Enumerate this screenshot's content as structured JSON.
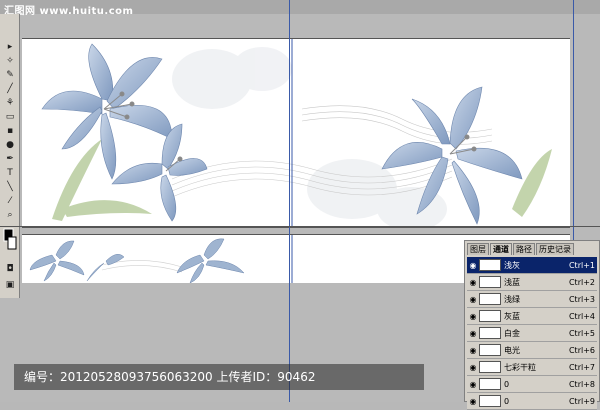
{
  "watermark": {
    "site": "汇图网 www.huitu.com"
  },
  "caption": {
    "text": "编号：20120528093756063200 上传者ID：90462"
  },
  "channels_panel": {
    "tabs": [
      {
        "label": "图层",
        "active": false
      },
      {
        "label": "通道",
        "active": true
      },
      {
        "label": "路径",
        "active": false
      },
      {
        "label": "历史记录",
        "active": false
      }
    ],
    "rows": [
      {
        "name": "浅灰",
        "shortcut": "Ctrl+1",
        "selected": true
      },
      {
        "name": "浅蓝",
        "shortcut": "Ctrl+2",
        "selected": false
      },
      {
        "name": "浅绿",
        "shortcut": "Ctrl+3",
        "selected": false
      },
      {
        "name": "灰蓝",
        "shortcut": "Ctrl+4",
        "selected": false
      },
      {
        "name": "白金",
        "shortcut": "Ctrl+5",
        "selected": false
      },
      {
        "name": "电光",
        "shortcut": "Ctrl+6",
        "selected": false
      },
      {
        "name": "七彩干粒",
        "shortcut": "Ctrl+7",
        "selected": false
      },
      {
        "name": "0",
        "shortcut": "Ctrl+8",
        "selected": false
      },
      {
        "name": "0",
        "shortcut": "Ctrl+9",
        "selected": false
      }
    ]
  },
  "colors": {
    "flower": "#9fb4d0",
    "leaf": "#b8cc9e",
    "selection": "#0a246a",
    "guide": "#3a5aa8"
  }
}
